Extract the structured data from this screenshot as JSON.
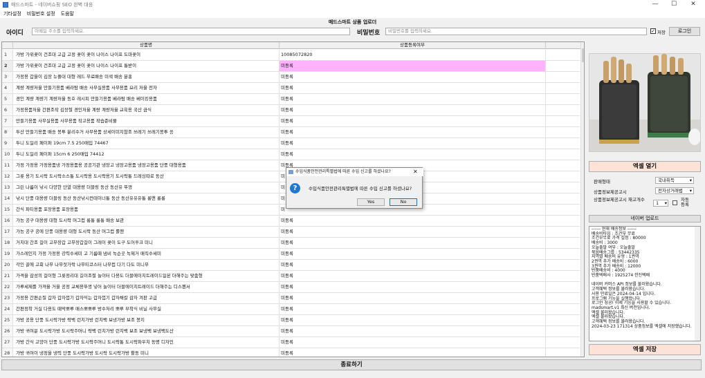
{
  "window": {
    "title": "매드스마트 - 네이버쇼핑 SEO 완벽 대응",
    "min": "—",
    "max": "☐",
    "close": "✕"
  },
  "menu": [
    "기타설정",
    "비밀번호 설정",
    "도움말"
  ],
  "app_title": "매드스마트 상품 업로더",
  "login": {
    "id_label": "아이디",
    "id_placeholder": "이메일 주소를 입력하세요.",
    "pw_label": "비밀번호",
    "pw_placeholder": "비밀번호를 입력하세요.",
    "save_label": "저장",
    "save_checked": "✓",
    "login_button": "로그인"
  },
  "table": {
    "headers": [
      "",
      "상품명",
      "상품등록여부"
    ],
    "rows": [
      {
        "n": "1",
        "name": "가방 가위꽂이 건조대 고급 고정 꽂이 꽂이 나이스 나이프 도마꽂이",
        "status": "10085072820"
      },
      {
        "n": "2",
        "name": "가방 가위꽂이 건조대 고급 고정 꽂이 꽂이 나이스 나이프 통받이",
        "status": "미등록"
      },
      {
        "n": "3",
        "name": "가정용 갑을이 김장 뉴플대 대형 레드 무료배송 미색 배송 분홍",
        "status": "미등록"
      },
      {
        "n": "4",
        "name": "계량 계량저울 만들기용품 베라탐 배송 사무실용품 사무용품 요리 저울 전자",
        "status": "미등록"
      },
      {
        "n": "5",
        "name": "경인 계량 계량기 계량저울 동호 레시피 만들기용품 베라탐 배송 베이킹용품",
        "status": "미등록"
      },
      {
        "n": "6",
        "name": "가정용품저울 간편조작 김장철 경인저울 계량 계량저울 교육용 국산 금식",
        "status": "미등록"
      },
      {
        "n": "7",
        "name": "만들기용품 사무실용품 사무용품 작고용품 작습준비물",
        "status": "미등록"
      },
      {
        "n": "8",
        "name": "두산 만들기용품 배송 봉투 분리수거 사무용품 상세이미지참조 쓰레기 쓰레기봉투 응",
        "status": "미등록"
      },
      {
        "n": "9",
        "name": "두니 도일리 페이퍼 19cm 7.5 250매입 74467",
        "status": "미등록"
      },
      {
        "n": "10",
        "name": "두니 도일리 페이퍼 15cm 6 250매입 74412",
        "status": "미등록"
      },
      {
        "n": "11",
        "name": "가정 가정용 가정용품냉 가정용품용 공공기관 냉장고 냉장고용품 냉장고용품 단풍 대형용품",
        "status": "미등록"
      },
      {
        "n": "12",
        "name": "그릇 용기 도시락 도시락소스통 도시락용 도시락용기 도시락통 드레싱따로 동산",
        "status": "미"
      },
      {
        "n": "13",
        "name": "그린 나름이 낚시 다양한 단열 대용량 더블링 동산 동산유 뚜껑",
        "status": "미"
      },
      {
        "n": "14",
        "name": "낚시 단풍 대용량 더블링 동산 동산낚시컨테이너통 동산 동산유유유통 롱맨 롱롱",
        "status": "미"
      },
      {
        "n": "15",
        "name": "간식 파티용품 포장용품 포장용품",
        "status": "미"
      },
      {
        "n": "16",
        "name": "가능 공구 대용량 대형 도시락 머그컵 롱통 롱통 배송 보관",
        "status": "미등록"
      },
      {
        "n": "17",
        "name": "가능 공구 공에 단풍 대용량 대형 도시락 동산 머그컵 롤맨",
        "status": "미등록"
      },
      {
        "n": "18",
        "name": "거치대 간조 걸이 고무장갑 고무장갑걸이 그레이 꽂이 도구 도어후크 미니",
        "status": "미등록"
      },
      {
        "n": "19",
        "name": "가스레인지 가정 가정용 강력수세미 고 기름때 냄비 녹슨곳 녹제거 매직수세미",
        "status": "미등록"
      },
      {
        "n": "20",
        "name": "각인 골에 고회 나무 나무젓가락 나무티코스터 나무컵 다기 다도 미니무",
        "status": "미등록"
      },
      {
        "n": "21",
        "name": "가격을 감성의 걸이형 그릇정리대 길이조절 놀이터 다용도 더블에이치트레이드일본 더해주는 맞춤형",
        "status": "미등록"
      },
      {
        "n": "22",
        "name": "가루세제를 가져올 거을 공정 교체용뚜껑 넣어 놀이터 더블에이치트레이드 더해주는 디스펜서",
        "status": "미등록"
      },
      {
        "n": "23",
        "name": "가정용 간편손질 갑자 갑자껍기 갑자믹는 갑자껍기 갑자채칼 감자 겨판 고급",
        "status": "미등록"
      },
      {
        "n": "24",
        "name": "간편정착 거실 다용도 때막뽀루 매스뽀뽀루 방수처리 뽀루 부착식 비닐 사무실",
        "status": "미등록"
      },
      {
        "n": "25",
        "name": "가방 공용 단풍 도시락가방 락백 런치가방 런치백 보냉가방 보조 봉지",
        "status": "미등록"
      },
      {
        "n": "26",
        "name": "가방 귀여운 도시락가방 도시락주머니 락백 런치가방 런치백 보조 보냉백 보냉백도산",
        "status": "미등록"
      },
      {
        "n": "27",
        "name": "가방 간식 고양이 단풍 도시락가방 도시락주머니 도시락통 도시락파우치 동명 디자인",
        "status": "미등록"
      },
      {
        "n": "28",
        "name": "가방 귀여이 냉정을 냉력 단풍 도시락가방 도시락 도시락가방 활동 미니",
        "status": "미등록"
      }
    ]
  },
  "right_panel": {
    "excel_open": "엑셀 열기",
    "sales_form_label": "판매형태",
    "sales_form_value": "국내취득",
    "notice_label": "상품정보제공고시",
    "notice_value": "전자상거래법",
    "notice_count_label": "상품정보제공고시 재고개수",
    "notice_count_value": "1",
    "auto_reg_label": "자동 등록",
    "naver_upload": "네이버 업로드",
    "info_lines": [
      "------ 현재 배송정보 ------",
      "배송비타입 : 조건부 무료",
      "조건부무료 가격 설정 : 80000",
      "배송비 : 3000",
      "오늘출발 여부 : 오늘출발",
      "묶음배송그룹 : 53442335",
      "지역별 배송비 유형 : 1권역",
      "2권역 추가 배송비 : 6000",
      "3권역 추가 배송비 : 12000",
      "반품배송비 : 4000",
      "반품택배사 : 1925274 한진택배",
      "",
      "네이버 커머스 API 정보를 불러왔습니다.",
      "고객혜택 정보를 불러왔습니다.",
      "사용 만료일은 2024-04-14 입니다.",
      "프로그램 기능을 실행합니다.",
      "로그인 성공! 이제 기능을 사용할 수 있습니다.",
      "madsmart.v1 최신 버전입니다.",
      "엑셀 불러왔습니다.",
      "엑셀 불러왔습니다.",
      "고객혜택 정보를 불러왔습니다.",
      "2024-03-23 171314 상품정보를 엑셀에 저장했습니다."
    ],
    "excel_save": "엑셀 저장"
  },
  "bottom_button": "종료하기",
  "dialog": {
    "title": "수입식품안전관리특별법에 따른 수입 신고를 하셨나요?",
    "message": "수입식품안전관리특별법에 따른 수입 신고를 하셨나요?",
    "yes": "Yes",
    "no": "No",
    "close": "✕"
  }
}
